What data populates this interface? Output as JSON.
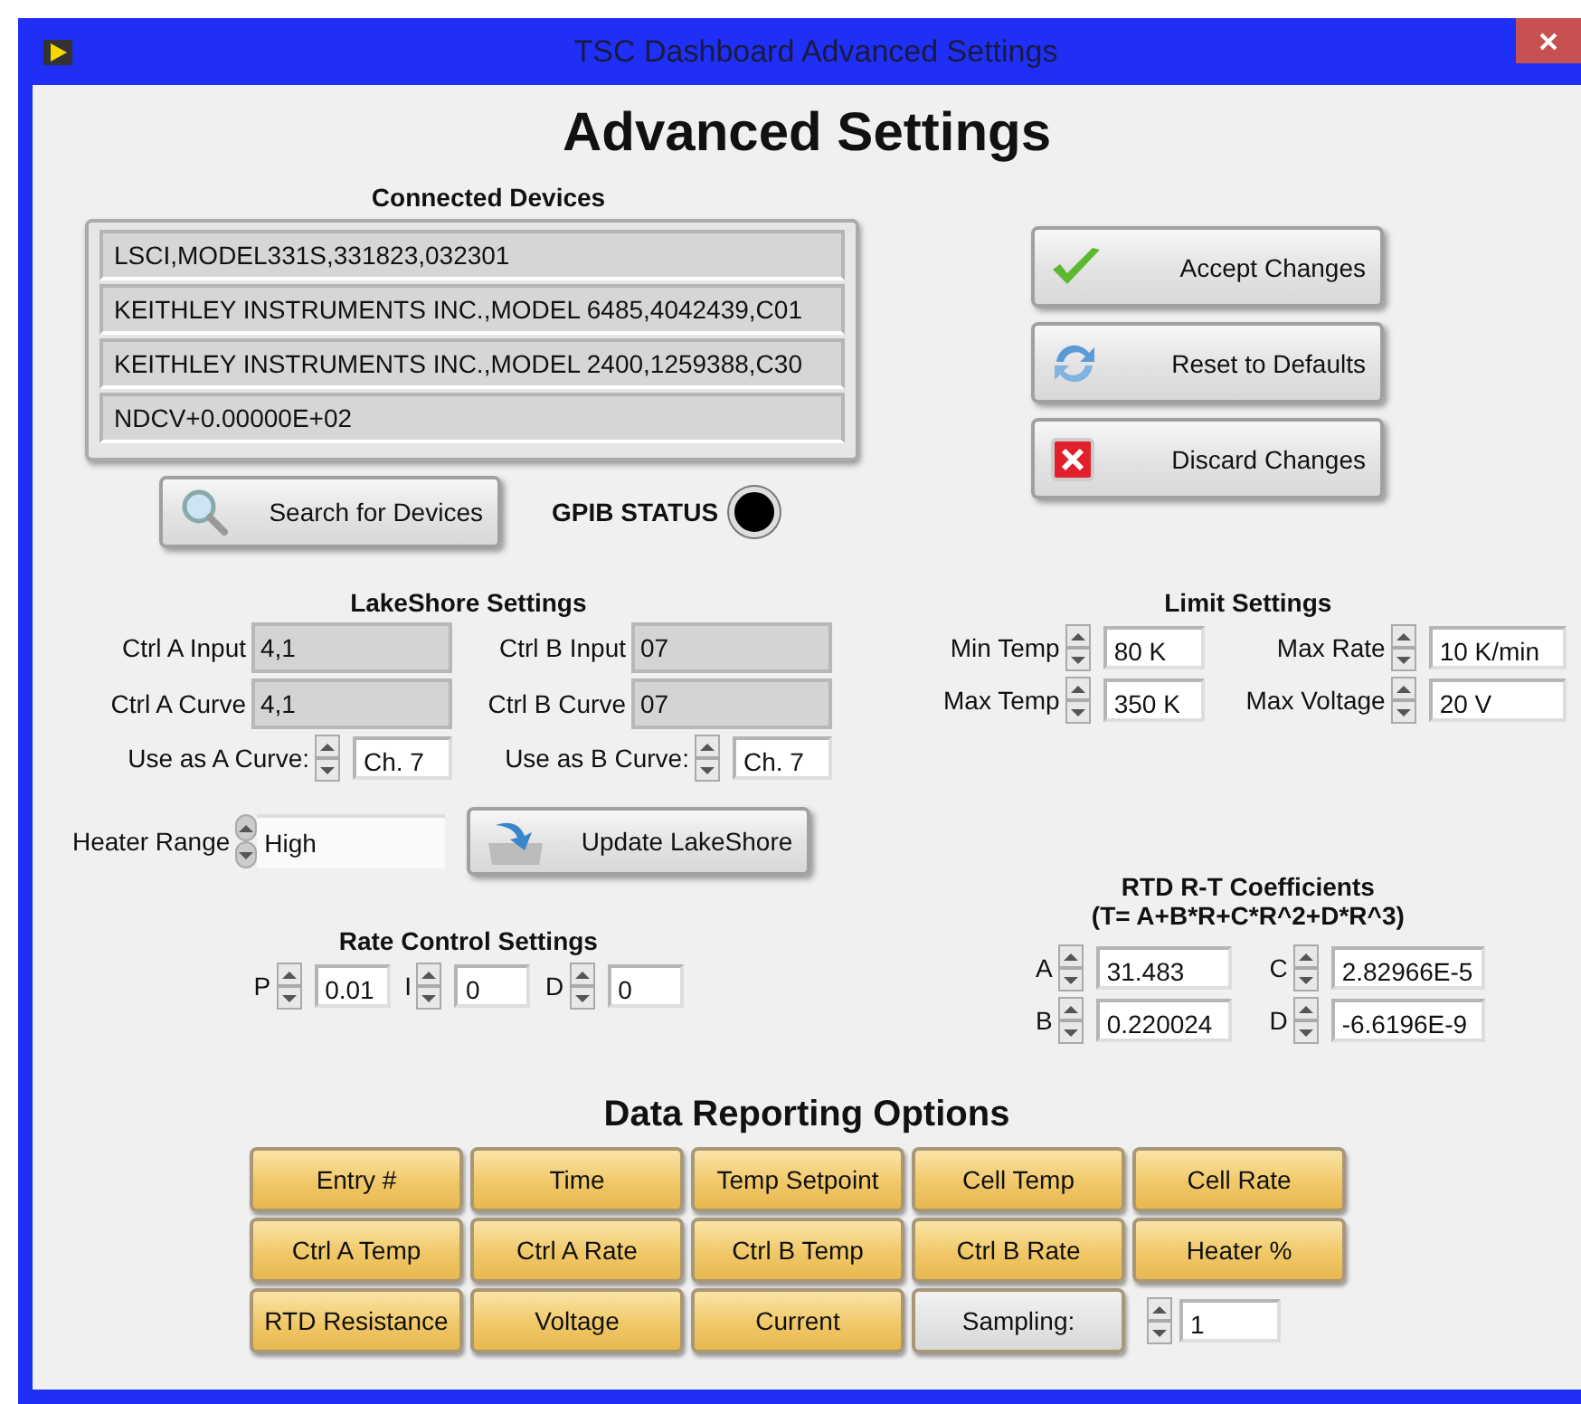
{
  "window": {
    "title": "TSC Dashboard Advanced Settings"
  },
  "heading": "Advanced Settings",
  "connected_devices": {
    "label": "Connected Devices",
    "items": [
      "LSCI,MODEL331S,331823,032301",
      "KEITHLEY INSTRUMENTS INC.,MODEL 6485,4042439,C01",
      "KEITHLEY INSTRUMENTS INC.,MODEL 2400,1259388,C30",
      "NDCV+0.00000E+02"
    ]
  },
  "search_button": "Search for Devices",
  "gpib_status": {
    "label": "GPIB STATUS",
    "on": false
  },
  "action_buttons": [
    {
      "label": "Accept Changes",
      "kind": "accept"
    },
    {
      "label": "Reset to Defaults",
      "kind": "reset"
    },
    {
      "label": "Discard Changes",
      "kind": "discard"
    }
  ],
  "lakeshore": {
    "title": "LakeShore Settings",
    "indicators": [
      {
        "label": "Ctrl A Input",
        "value": "4,1"
      },
      {
        "label": "Ctrl B Input",
        "value": "07"
      },
      {
        "label": "Ctrl A Curve",
        "value": "4,1"
      },
      {
        "label": "Ctrl B Curve",
        "value": "07"
      }
    ],
    "curves": [
      {
        "label": "Use as A Curve:",
        "value": "Ch. 7"
      },
      {
        "label": "Use as B Curve:",
        "value": "Ch. 7"
      }
    ],
    "heater_range": {
      "label": "Heater Range",
      "value": "High"
    },
    "update_button": "Update LakeShore"
  },
  "rate_control": {
    "title": "Rate Control Settings",
    "fields": [
      {
        "label": "P",
        "value": "0.01"
      },
      {
        "label": "I",
        "value": "0"
      },
      {
        "label": "D",
        "value": "0"
      }
    ]
  },
  "limits": {
    "title": "Limit Settings",
    "fields": [
      {
        "label": "Min Temp",
        "value": "80 K"
      },
      {
        "label": "Max Rate",
        "value": "10 K/min"
      },
      {
        "label": "Max Temp",
        "value": "350 K"
      },
      {
        "label": "Max Voltage",
        "value": "20 V"
      }
    ]
  },
  "rtd": {
    "title": "RTD R-T Coefficients",
    "formula": "(T= A+B*R+C*R^2+D*R^3)",
    "fields": [
      {
        "label": "A",
        "value": "31.483"
      },
      {
        "label": "C",
        "value": "2.82966E-5"
      },
      {
        "label": "B",
        "value": "0.220024"
      },
      {
        "label": "D",
        "value": "-6.6196E-9"
      }
    ]
  },
  "reporting": {
    "title": "Data Reporting Options",
    "options": [
      {
        "label": "Entry #",
        "on": true
      },
      {
        "label": "Time",
        "on": true
      },
      {
        "label": "Temp Setpoint",
        "on": true
      },
      {
        "label": "Cell Temp",
        "on": true
      },
      {
        "label": "Cell Rate",
        "on": true
      },
      {
        "label": "Ctrl A Temp",
        "on": true
      },
      {
        "label": "Ctrl A Rate",
        "on": true
      },
      {
        "label": "Ctrl B Temp",
        "on": true
      },
      {
        "label": "Ctrl B Rate",
        "on": true
      },
      {
        "label": "Heater %",
        "on": true
      },
      {
        "label": "RTD Resistance",
        "on": true
      },
      {
        "label": "Voltage",
        "on": true
      },
      {
        "label": "Current",
        "on": true
      },
      {
        "label": "Sampling:",
        "on": false
      }
    ],
    "sampling_value": "1"
  }
}
